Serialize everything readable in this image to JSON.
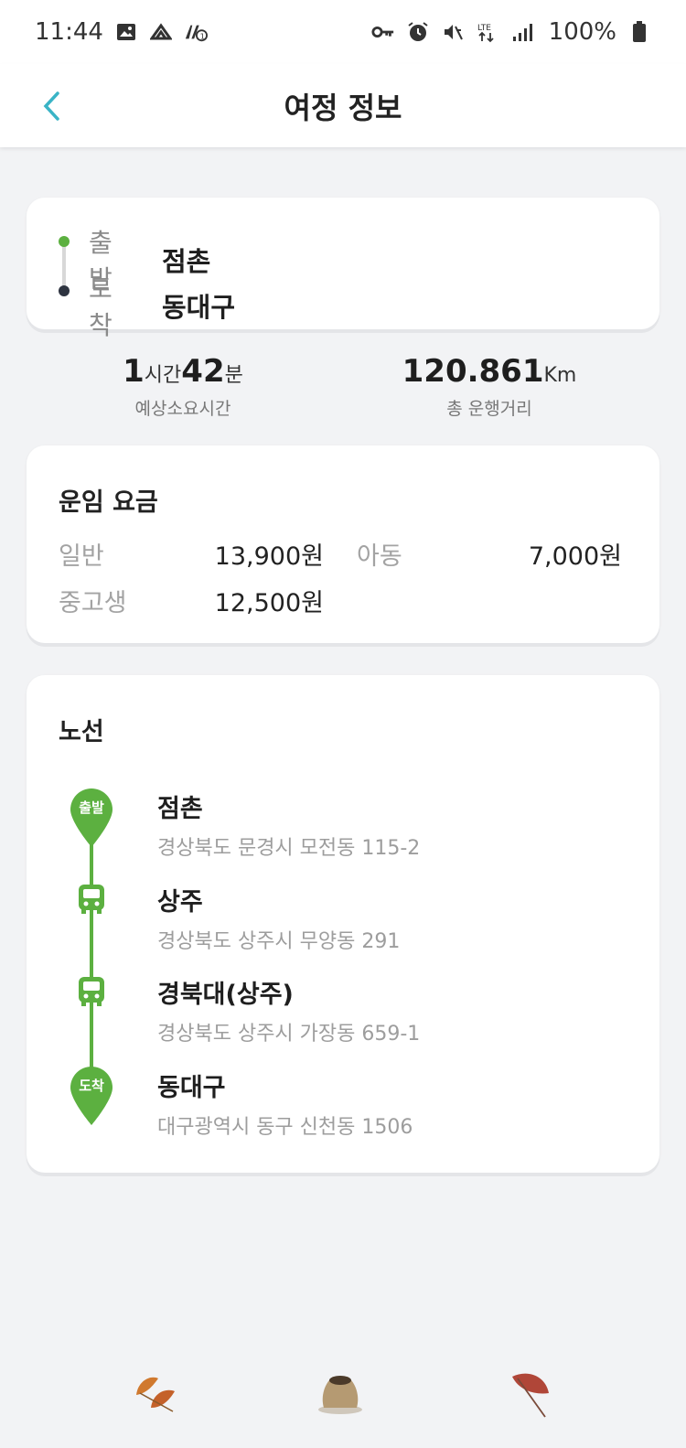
{
  "status_bar": {
    "time": "11:44",
    "left_icons": [
      "image-icon",
      "cloud-upload-icon",
      "notification-icon"
    ],
    "right_icons": [
      "vpn-key-icon",
      "alarm-icon",
      "mute-icon",
      "lte-icon",
      "signal-icon"
    ],
    "battery_percent": "100%"
  },
  "header": {
    "title": "여정 정보",
    "back_icon": "chevron-left-icon",
    "accent_color": "#3ab4c6"
  },
  "route": {
    "departure_label": "출발",
    "departure_value": "점촌",
    "arrival_label": "도착",
    "arrival_value": "동대구"
  },
  "summary": {
    "duration_hours": "1",
    "duration_hours_unit": "시간",
    "duration_minutes": "42",
    "duration_minutes_unit": "분",
    "duration_label": "예상소요시간",
    "distance_value": "120.861",
    "distance_unit": "Km",
    "distance_label": "총 운행거리"
  },
  "fare": {
    "title": "운임 요금",
    "items": [
      {
        "label": "일반",
        "value": "13,900원"
      },
      {
        "label": "아동",
        "value": "7,000원"
      },
      {
        "label": "중고생",
        "value": "12,500원"
      }
    ]
  },
  "line": {
    "title": "노선",
    "start_badge": "출발",
    "end_badge": "도착",
    "line_color": "#5cb040",
    "stops": [
      {
        "name": "점촌",
        "address": "경상북도 문경시 모전동 115-2"
      },
      {
        "name": "상주",
        "address": "경상북도 상주시 무양동 291"
      },
      {
        "name": "경북대(상주)",
        "address": "경상북도 상주시 가장동 659-1"
      },
      {
        "name": "동대구",
        "address": "대구광역시 동구 신천동 1506"
      }
    ]
  },
  "footer": {
    "icons": [
      "autumn-leaf-icon",
      "grain-sack-icon",
      "red-leaf-icon"
    ]
  }
}
